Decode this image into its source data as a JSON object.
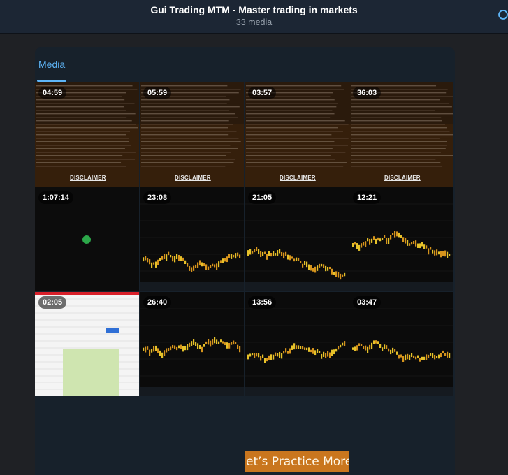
{
  "header": {
    "title": "Gui Trading MTM - Master trading in markets",
    "subtitle": "33 media",
    "search_icon": "search-icon"
  },
  "tabs": [
    {
      "label": "Media",
      "active": true
    }
  ],
  "media": [
    {
      "duration": "04:59",
      "kind": "disclaimer",
      "heading": "DISCLAIMER"
    },
    {
      "duration": "05:59",
      "kind": "disclaimer",
      "heading": "DISCLAIMER"
    },
    {
      "duration": "03:57",
      "kind": "disclaimer",
      "heading": "DISCLAIMER"
    },
    {
      "duration": "36:03",
      "kind": "disclaimer",
      "heading": "DISCLAIMER"
    },
    {
      "duration": "1:07:14",
      "kind": "blank"
    },
    {
      "duration": "23:08",
      "kind": "chart"
    },
    {
      "duration": "21:05",
      "kind": "chart"
    },
    {
      "duration": "12:21",
      "kind": "chart"
    },
    {
      "duration": "02:05",
      "kind": "spreadsheet"
    },
    {
      "duration": "26:40",
      "kind": "chart"
    },
    {
      "duration": "13:56",
      "kind": "chart",
      "overlay": "et’s Practice More!!"
    },
    {
      "duration": "03:47",
      "kind": "chart"
    }
  ],
  "colors": {
    "accent": "#5eb5f7",
    "header_bg": "#1c2634",
    "panel_bg": "#17212b",
    "page_bg": "#1f2125"
  }
}
